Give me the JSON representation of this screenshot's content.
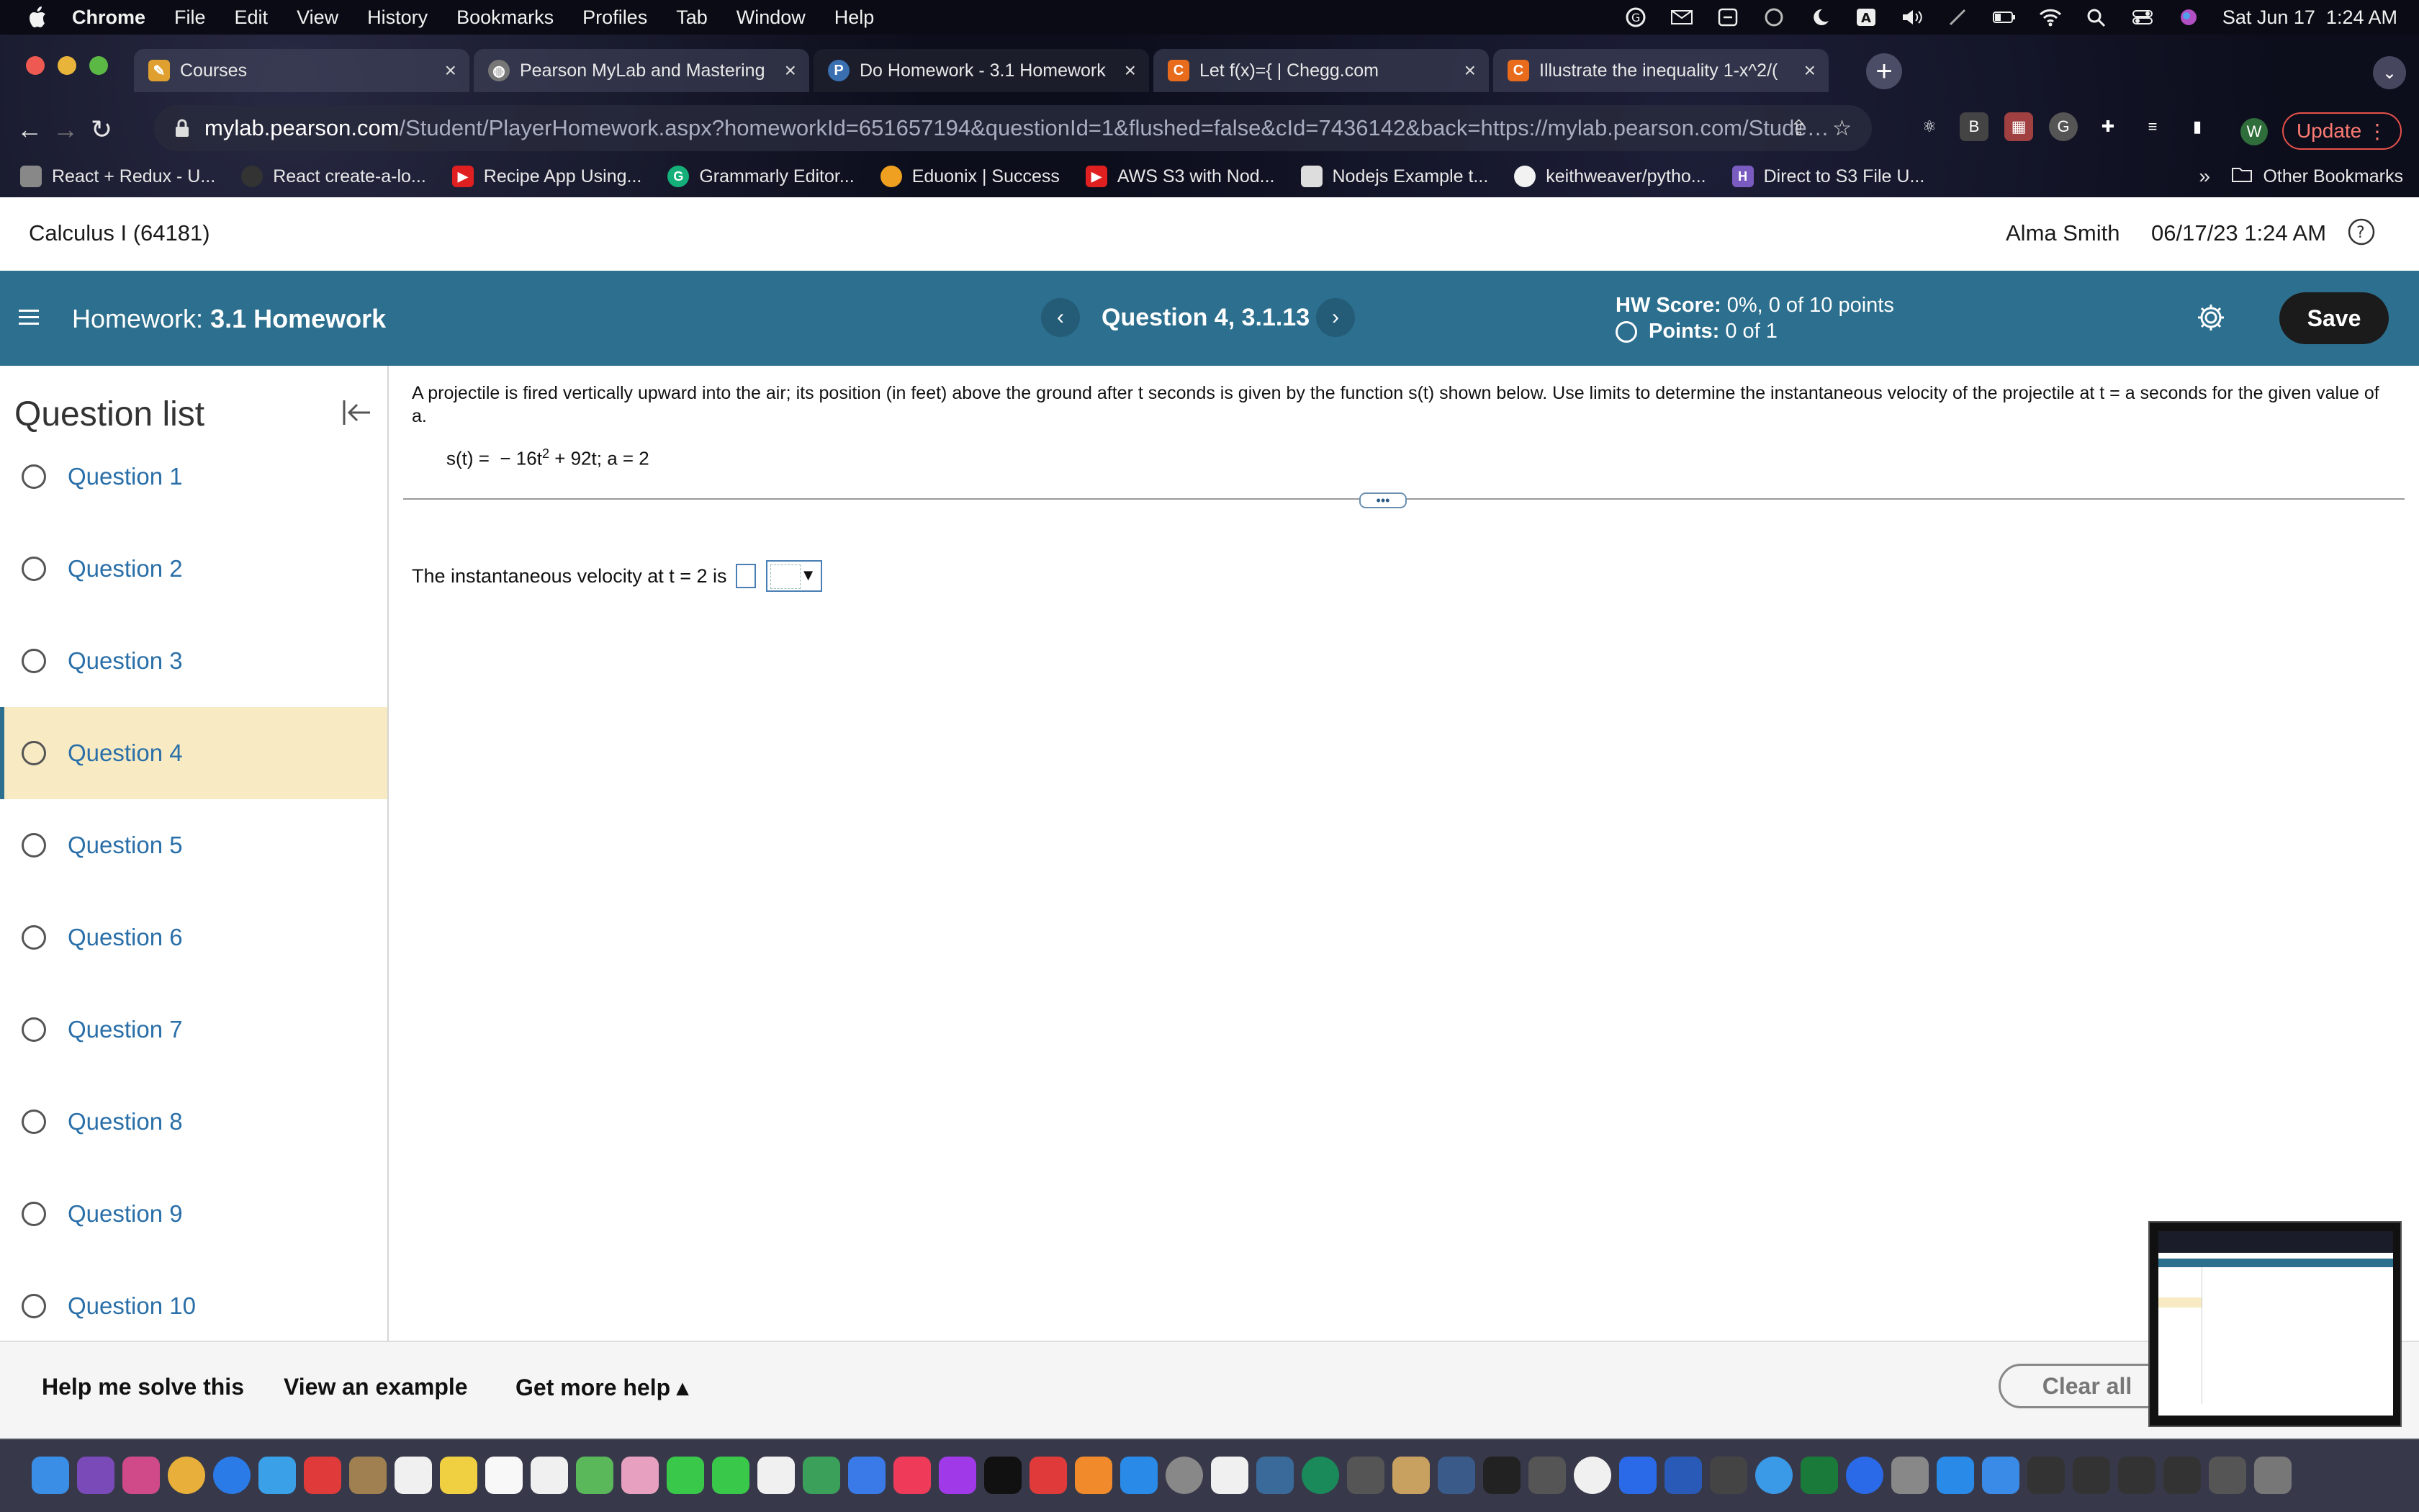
{
  "menubar": {
    "app": "Chrome",
    "items": [
      "File",
      "Edit",
      "View",
      "History",
      "Bookmarks",
      "Profiles",
      "Tab",
      "Window",
      "Help"
    ],
    "clock": "Sat Jun 17  1:24 AM",
    "input_indicator": "A"
  },
  "tabs": [
    {
      "label": "Courses",
      "icon": "pencil-favicon",
      "color": "#e0a030"
    },
    {
      "label": "Pearson MyLab and Mastering",
      "icon": "globe-favicon",
      "color": "#777"
    },
    {
      "label": "Do Homework - 3.1 Homework",
      "icon": "pearson-favicon",
      "color": "#3a6fb0",
      "icon_text": "P"
    },
    {
      "label": "Let f(x)={ | Chegg.com",
      "icon": "chegg-favicon",
      "color": "#e86c1c",
      "icon_text": "C"
    },
    {
      "label": "Illustrate the inequality 1-x^2/(",
      "icon": "chegg-favicon",
      "color": "#e86c1c",
      "icon_text": "C"
    }
  ],
  "address": {
    "host": "mylab.pearson.com",
    "path": "/Student/PlayerHomework.aspx?homeworkId=651657194&questionId=1&flushed=false&cId=7436142&back=https://mylab.pearson.com/Student/D..."
  },
  "profile_initial": "W",
  "update_label": "Update",
  "bookmarks": [
    {
      "label": "React + Redux - U...",
      "color": "#888"
    },
    {
      "label": "React create-a-lo...",
      "color": "#333"
    },
    {
      "label": "Recipe App Using...",
      "color": "#e02020"
    },
    {
      "label": "Grammarly Editor...",
      "color": "#15b07a",
      "icon_text": "G"
    },
    {
      "label": "Eduonix | Success",
      "color": "#f0a020"
    },
    {
      "label": "AWS S3 with Nod...",
      "color": "#e02020"
    },
    {
      "label": "Nodejs Example t...",
      "color": "#ddd"
    },
    {
      "label": "keithweaver/pytho...",
      "color": "#111"
    },
    {
      "label": "Direct to S3 File U...",
      "color": "#7a5cc0",
      "icon_text": "H"
    }
  ],
  "bookmarks_more": "»",
  "bookmarks_other": "Other Bookmarks",
  "course": {
    "title": "Calculus I (64181)",
    "user": "Alma Smith",
    "datetime": "06/17/23 1:24 AM"
  },
  "homework": {
    "prefix": "Homework:",
    "name": "3.1 Homework",
    "question": "Question 4, 3.1.13",
    "score_label": "HW Score:",
    "score_value": "0%, 0 of 10 points",
    "points_label": "Points:",
    "points_value": "0 of 1",
    "save_label": "Save"
  },
  "question_list": {
    "title": "Question list",
    "items": [
      "Question 1",
      "Question 2",
      "Question 3",
      "Question 4",
      "Question 5",
      "Question 6",
      "Question 7",
      "Question 8",
      "Question 9",
      "Question 10"
    ],
    "active_index": 3
  },
  "question": {
    "prompt": "A projectile is fired vertically upward into the air; its position (in feet) above the ground after t seconds is given by the function s(t) shown below.  Use limits to determine the instantaneous velocity of the projectile at t = a seconds for the given value of a.",
    "formula_left": "s(t) =  − 16t",
    "formula_exp": "2",
    "formula_right": " + 92t; a = 2",
    "answer_prefix": "The instantaneous velocity at t = 2 is",
    "answer_value": ""
  },
  "bottom": {
    "help_solve": "Help me solve this",
    "example": "View an example",
    "more_help": "Get more help ▴",
    "clear_all": "Clear all"
  },
  "colors": {
    "header": "#2c6f8e",
    "active_question": "#f8ebc3",
    "link": "#2a6fa8"
  }
}
